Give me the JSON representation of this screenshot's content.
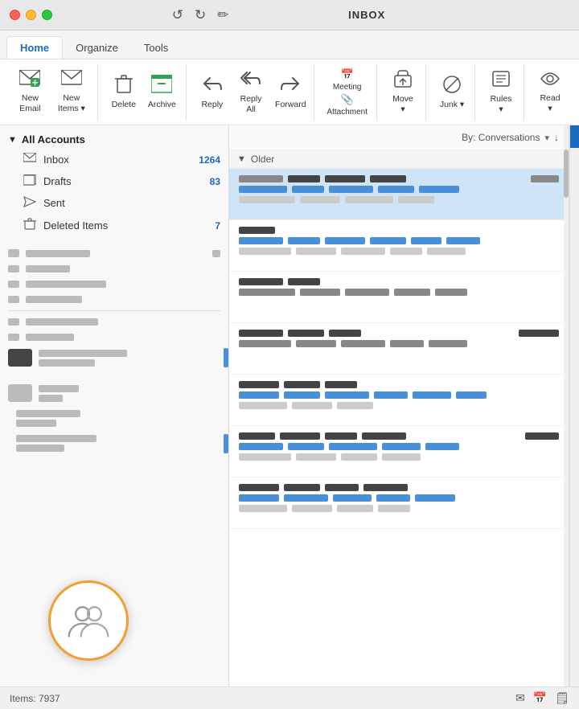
{
  "titleBar": {
    "title": "INBOX",
    "undoLabel": "Undo",
    "redoLabel": "Redo"
  },
  "tabs": [
    {
      "id": "home",
      "label": "Home",
      "active": true
    },
    {
      "id": "organize",
      "label": "Organize",
      "active": false
    },
    {
      "id": "tools",
      "label": "Tools",
      "active": false
    }
  ],
  "ribbon": {
    "groups": [
      {
        "id": "new",
        "buttons": [
          {
            "id": "new-email",
            "icon": "✉",
            "label": "New\nEmail"
          },
          {
            "id": "new-items",
            "icon": "✉",
            "label": "New\nItems",
            "dropdown": true
          }
        ]
      },
      {
        "id": "delete",
        "buttons": [
          {
            "id": "delete",
            "icon": "🗑",
            "label": "Delete"
          },
          {
            "id": "archive",
            "icon": "📥",
            "label": "Archive",
            "highlighted": true
          }
        ]
      },
      {
        "id": "respond",
        "buttons": [
          {
            "id": "reply",
            "icon": "↩",
            "label": "Reply"
          },
          {
            "id": "reply-all",
            "icon": "↩↩",
            "label": "Reply\nAll"
          },
          {
            "id": "forward",
            "icon": "↪",
            "label": "Forward"
          }
        ]
      },
      {
        "id": "quick-steps",
        "buttons": [
          {
            "id": "meeting",
            "icon": "📅",
            "label": "Meeting"
          },
          {
            "id": "attachment",
            "icon": "📎",
            "label": "Attachment"
          }
        ]
      },
      {
        "id": "move-group",
        "buttons": [
          {
            "id": "move",
            "icon": "⬆",
            "label": "Move",
            "dropdown": true
          }
        ]
      },
      {
        "id": "junk-group",
        "buttons": [
          {
            "id": "junk",
            "icon": "🚫",
            "label": "Junk",
            "dropdown": true
          }
        ]
      },
      {
        "id": "rules-group",
        "buttons": [
          {
            "id": "rules",
            "icon": "📋",
            "label": "Rules",
            "dropdown": true
          }
        ]
      },
      {
        "id": "read-group",
        "buttons": [
          {
            "id": "read",
            "icon": "👁",
            "label": "Read",
            "dropdown": true
          }
        ]
      }
    ]
  },
  "sidebar": {
    "allAccounts": "All Accounts",
    "items": [
      {
        "id": "inbox",
        "icon": "inbox",
        "label": "Inbox",
        "count": "1264"
      },
      {
        "id": "drafts",
        "icon": "drafts",
        "label": "Drafts",
        "count": "83"
      },
      {
        "id": "sent",
        "icon": "sent",
        "label": "Sent",
        "count": ""
      },
      {
        "id": "deleted",
        "icon": "deleted",
        "label": "Deleted Items",
        "count": "7"
      }
    ],
    "redactedRows": 8
  },
  "emailList": {
    "sortLabel": "By: Conversations",
    "sectionLabel": "Older",
    "items": [
      {
        "id": 1,
        "selected": true
      },
      {
        "id": 2,
        "selected": false
      },
      {
        "id": 3,
        "selected": false
      },
      {
        "id": 4,
        "selected": false
      },
      {
        "id": 5,
        "selected": false
      },
      {
        "id": 6,
        "selected": false
      },
      {
        "id": 7,
        "selected": false
      }
    ]
  },
  "statusBar": {
    "itemsLabel": "Items: 7937"
  },
  "peopleButton": {
    "label": "People"
  }
}
